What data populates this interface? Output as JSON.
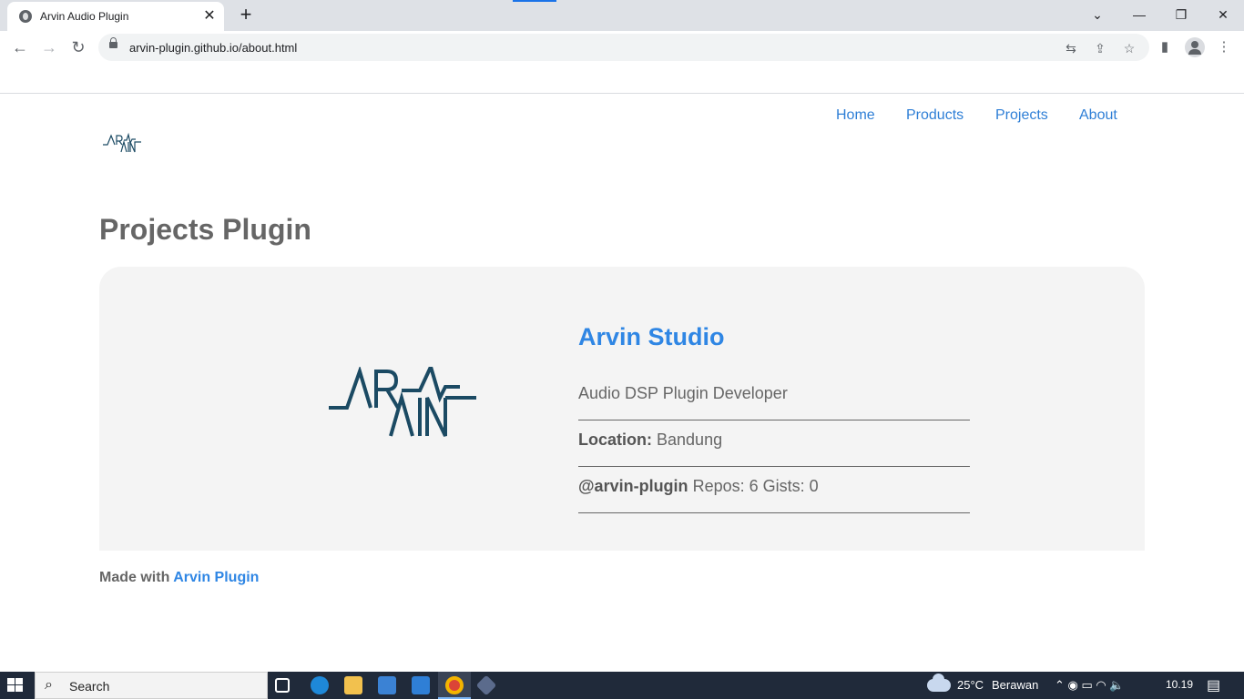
{
  "browser": {
    "tab_title": "Arvin Audio Plugin",
    "tab_close": "✕",
    "new_tab": "+",
    "url": "arvin-plugin.github.io/about.html",
    "window_controls": {
      "minimize": "—",
      "restore": "❐",
      "close": "✕",
      "tab_search": "⌄"
    },
    "nav": {
      "back": "←",
      "forward": "→",
      "reload": "↻"
    },
    "toolbar_icons": {
      "translate": "⇆",
      "share": "⇪",
      "bookmark": "☆",
      "side_panel": "▮",
      "menu": "⋮"
    }
  },
  "site": {
    "nav": [
      {
        "label": "Home"
      },
      {
        "label": "Products"
      },
      {
        "label": "Projects"
      },
      {
        "label": "About"
      }
    ],
    "logo_text": "ARVIN"
  },
  "main": {
    "title": "Projects Plugin",
    "profile": {
      "name": "Arvin Studio",
      "tagline": "Audio DSP Plugin Developer",
      "location_label": "Location:",
      "location_value": "Bandung",
      "handle": "@arvin-plugin",
      "stats": "Repos: 6 Gists: 0"
    },
    "footer": {
      "prefix": "Made with",
      "link": "Arvin Plugin"
    }
  },
  "colors": {
    "link_blue": "#2f86e4",
    "text_gray": "#666666",
    "card_bg": "#f4f4f4",
    "logo_navy": "#1b4a63"
  },
  "taskbar": {
    "search_icon": "⌕",
    "search_label": "Search",
    "weather": "25°C",
    "weather_desc": "Berawan",
    "tray_icons": "⌃  ◉  ▭  ◠  🔈",
    "time": "10.19",
    "notification_icon": "▤"
  }
}
